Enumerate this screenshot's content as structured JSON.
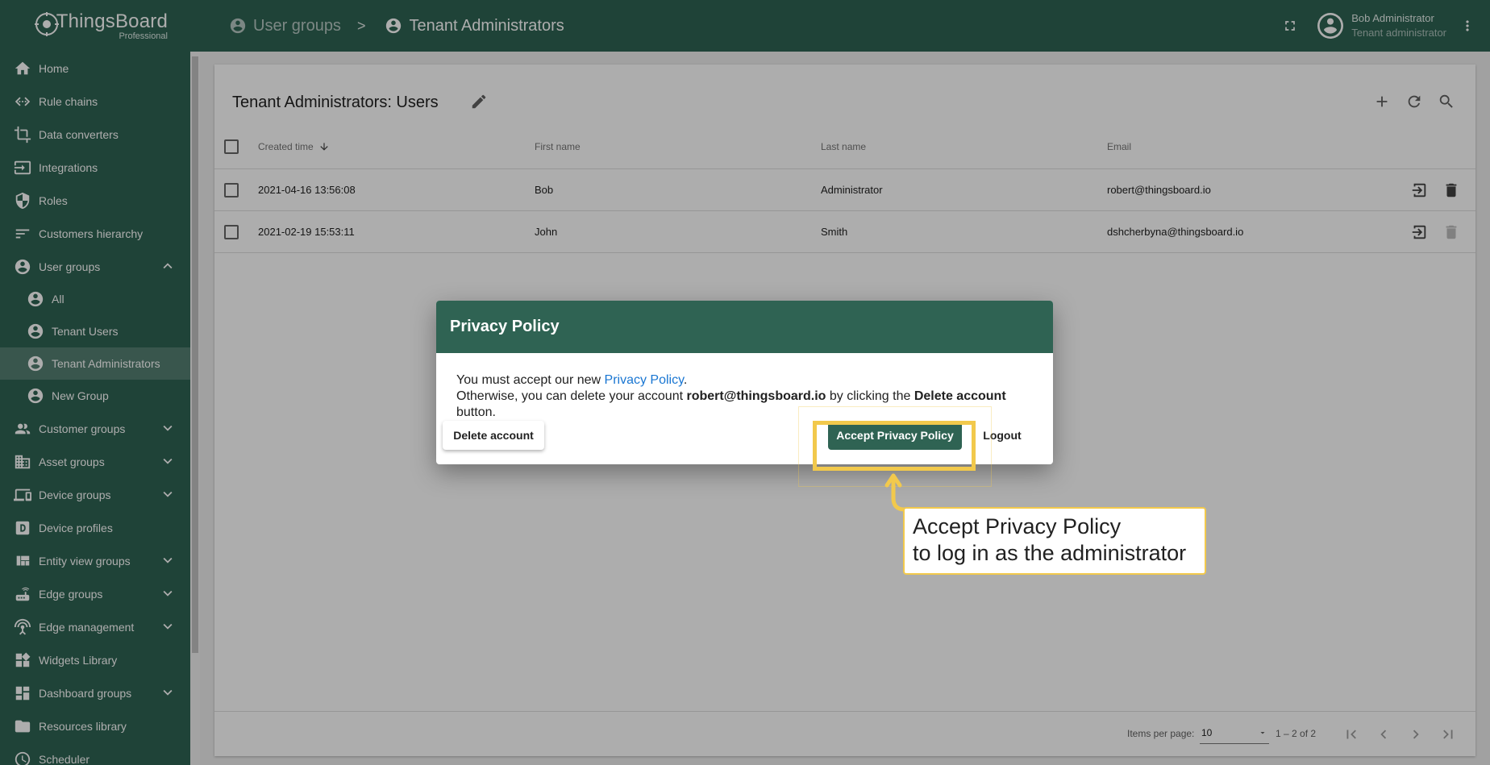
{
  "app": {
    "name": "ThingsBoard",
    "edition": "Professional"
  },
  "breadcrumb": {
    "parent": "User groups",
    "separator": ">",
    "current": "Tenant Administrators"
  },
  "user": {
    "name": "Bob Administrator",
    "role": "Tenant administrator"
  },
  "sidebar": {
    "items": [
      {
        "label": "Home",
        "icon": "home-icon"
      },
      {
        "label": "Rule chains",
        "icon": "rule-chain-icon"
      },
      {
        "label": "Data converters",
        "icon": "crop-icon"
      },
      {
        "label": "Integrations",
        "icon": "input-icon"
      },
      {
        "label": "Roles",
        "icon": "security-icon"
      },
      {
        "label": "Customers hierarchy",
        "icon": "sort-icon"
      },
      {
        "label": "User groups",
        "icon": "account-circle-icon"
      },
      {
        "label": "All",
        "icon": "account-circle-icon"
      },
      {
        "label": "Tenant Users",
        "icon": "account-circle-icon"
      },
      {
        "label": "Tenant Administrators",
        "icon": "account-circle-icon"
      },
      {
        "label": "New Group",
        "icon": "account-circle-icon"
      },
      {
        "label": "Customer groups",
        "icon": "supervisor-icon"
      },
      {
        "label": "Asset groups",
        "icon": "domain-icon"
      },
      {
        "label": "Device groups",
        "icon": "devices-icon"
      },
      {
        "label": "Device profiles",
        "icon": "device-profile-icon"
      },
      {
        "label": "Entity view groups",
        "icon": "view-quilt-icon"
      },
      {
        "label": "Edge groups",
        "icon": "router-icon"
      },
      {
        "label": "Edge management",
        "icon": "settings-input-antenna-icon"
      },
      {
        "label": "Widgets Library",
        "icon": "widgets-icon"
      },
      {
        "label": "Dashboard groups",
        "icon": "dashboard-icon"
      },
      {
        "label": "Resources library",
        "icon": "folder-icon"
      },
      {
        "label": "Scheduler",
        "icon": "schedule-icon"
      }
    ]
  },
  "table": {
    "title": "Tenant Administrators: Users",
    "columns": [
      "Created time",
      "First name",
      "Last name",
      "Email"
    ],
    "rows": [
      {
        "created": "2021-04-16 13:56:08",
        "first": "Bob",
        "last": "Administrator",
        "email": "robert@thingsboard.io"
      },
      {
        "created": "2021-02-19 15:53:11",
        "first": "John",
        "last": "Smith",
        "email": "dshcherbyna@thingsboard.io"
      }
    ]
  },
  "paginator": {
    "items_per_page_label": "Items per page:",
    "items_per_page": "10",
    "range": "1 – 2 of 2"
  },
  "dialog": {
    "title": "Privacy Policy",
    "line1_prefix": "You must accept our new ",
    "line1_link": "Privacy Policy",
    "line1_suffix": ".",
    "line2_a": "Otherwise, you can delete your account ",
    "line2_email": "robert@thingsboard.io",
    "line2_b": " by clicking the ",
    "line2_button": "Delete account",
    "line2_c": " button.",
    "delete_label": "Delete account",
    "accept_label": "Accept Privacy Policy",
    "logout_label": "Logout"
  },
  "annotation": {
    "line1": "Accept Privacy Policy",
    "line2": "to log in as the administrator",
    "color": "#f2c94c"
  },
  "colors": {
    "primary": "#2f6353",
    "link": "#1976d2"
  }
}
